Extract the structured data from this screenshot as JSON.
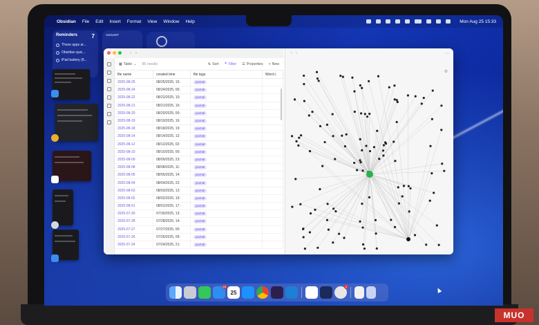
{
  "menubar": {
    "app_name": "Obsidian",
    "menus": [
      "File",
      "Edit",
      "Insert",
      "Format",
      "View",
      "Window",
      "Help"
    ],
    "clock": "Mon Aug 25  15:33"
  },
  "widgets": {
    "reminders": {
      "title": "Reminders",
      "count": "7",
      "items": [
        "These apps ar...",
        "Obsidian quic...",
        "iPad battery (8..."
      ]
    },
    "calendar": {
      "month": "AUGUST"
    }
  },
  "obsidian": {
    "toolbar": {
      "view_label": "Table",
      "results": "85 results",
      "sort": "Sort",
      "filter": "Filter",
      "properties": "Properties",
      "new": "New"
    },
    "columns": [
      "file name",
      "created time",
      "file tags",
      "Word c"
    ],
    "rows": [
      {
        "name": "2025-08-25",
        "created": "08/25/2025, 15:",
        "tag": "journal"
      },
      {
        "name": "2025-08-24",
        "created": "08/24/2025, 00:",
        "tag": "journal"
      },
      {
        "name": "2025-08-22",
        "created": "08/22/2025, 10:",
        "tag": "journal"
      },
      {
        "name": "2025-08-21",
        "created": "08/21/2025, 16:",
        "tag": "journal"
      },
      {
        "name": "2025-08-20",
        "created": "08/20/2025, 00:",
        "tag": "journal"
      },
      {
        "name": "2025-08-19",
        "created": "08/19/2025, 16:",
        "tag": "journal"
      },
      {
        "name": "2025-08-18",
        "created": "08/18/2025, 19:",
        "tag": "journal"
      },
      {
        "name": "2025-08-14",
        "created": "08/14/2025, 12:",
        "tag": "journal"
      },
      {
        "name": "2025-08-12",
        "created": "08/12/2025, 02:",
        "tag": "journal"
      },
      {
        "name": "2025-08-10",
        "created": "08/10/2025, 00:",
        "tag": "journal"
      },
      {
        "name": "2025-08-09",
        "created": "08/09/2025, 23:",
        "tag": "journal"
      },
      {
        "name": "2025-08-08",
        "created": "08/08/2025, 11:",
        "tag": "journal"
      },
      {
        "name": "2025-08-05",
        "created": "08/05/2025, 14:",
        "tag": "journal"
      },
      {
        "name": "2025-08-04",
        "created": "08/04/2025, 22:",
        "tag": "journal"
      },
      {
        "name": "2025-08-03",
        "created": "08/03/2025, 12:",
        "tag": "journal"
      },
      {
        "name": "2025-08-02",
        "created": "08/02/2025, 19:",
        "tag": "journal"
      },
      {
        "name": "2025-08-01",
        "created": "08/01/2025, 17:",
        "tag": "journal"
      },
      {
        "name": "2025-07-30",
        "created": "07/30/2025, 13:",
        "tag": "journal"
      },
      {
        "name": "2025-07-28",
        "created": "07/28/2025, 14:",
        "tag": "journal"
      },
      {
        "name": "2025-07-27",
        "created": "07/27/2025, 00:",
        "tag": "journal"
      },
      {
        "name": "2025-07-26",
        "created": "07/26/2025, 09:",
        "tag": "journal"
      },
      {
        "name": "2025-07-24",
        "created": "07/24/2025, 21:",
        "tag": "journal"
      }
    ]
  },
  "dock": {
    "mail_badge": "14",
    "calendar_date": "25",
    "store_badge": "1"
  },
  "watermark": "MUO",
  "colors": {
    "accent": "#7a5af5",
    "graph_highlight": "#2bb24c",
    "tag_bg": "#e8e2ff"
  }
}
